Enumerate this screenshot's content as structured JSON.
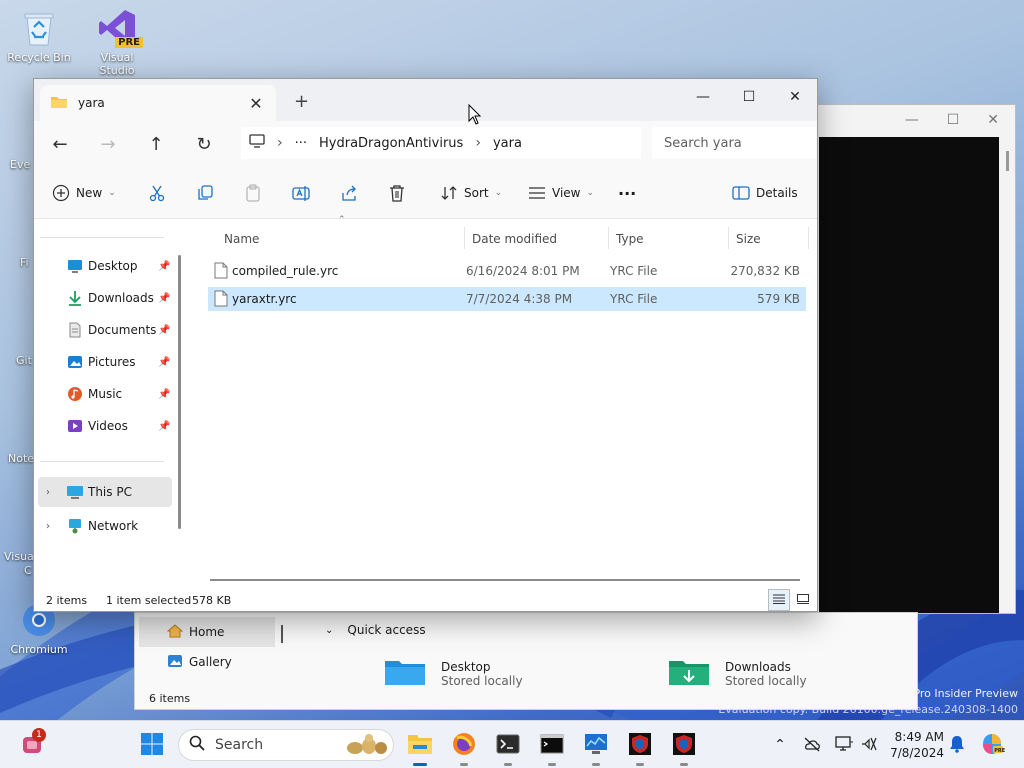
{
  "desktop": {
    "icons": [
      {
        "label": "Recycle Bin"
      },
      {
        "label": "Visual Studio",
        "badge": "PRE"
      }
    ],
    "edge_labels": [
      "Eve",
      "Fi",
      "Git",
      "Note",
      "Visua",
      "C",
      "Chromium"
    ],
    "watermark": [
      "Pro Insider Preview",
      "Evaluation copy. Build 26100.ge_release.240308-1400"
    ]
  },
  "explorer": {
    "tab_title": "yara",
    "window_controls": {
      "minimize": "—",
      "maximize": "☐",
      "close": "✕"
    },
    "breadcrumb": {
      "more": "···",
      "parts": [
        "HydraDragonAntivirus",
        "yara"
      ]
    },
    "search_placeholder": "Search yara",
    "toolbar": {
      "new": "New",
      "sort": "Sort",
      "view": "View",
      "more": "···",
      "details": "Details"
    },
    "nav": {
      "quick": [
        {
          "label": "Desktop",
          "icon": "desktop-icon",
          "color": "#1a8fd8"
        },
        {
          "label": "Downloads",
          "icon": "download-icon",
          "color": "#1a9e5c"
        },
        {
          "label": "Documents",
          "icon": "document-icon",
          "color": "#8a8a8a"
        },
        {
          "label": "Pictures",
          "icon": "picture-icon",
          "color": "#1a7fd4"
        },
        {
          "label": "Music",
          "icon": "music-icon",
          "color": "#e05a2b"
        },
        {
          "label": "Videos",
          "icon": "video-icon",
          "color": "#7b3fc4"
        }
      ],
      "this_pc": "This PC",
      "network": "Network"
    },
    "columns": {
      "name": "Name",
      "date": "Date modified",
      "type": "Type",
      "size": "Size"
    },
    "files": [
      {
        "name": "compiled_rule.yrc",
        "date": "6/16/2024 8:01 PM",
        "type": "YRC File",
        "size": "270,832 KB",
        "selected": false
      },
      {
        "name": "yaraxtr.yrc",
        "date": "7/7/2024 4:38 PM",
        "type": "YRC File",
        "size": "579 KB",
        "selected": true
      }
    ],
    "status": {
      "count": "2 items",
      "selected": "1 item selected",
      "size": "578 KB"
    }
  },
  "bg_explorer": {
    "nav": [
      "Home",
      "Gallery"
    ],
    "section": "Quick access",
    "tiles": [
      {
        "name": "Desktop",
        "sub": "Stored locally"
      },
      {
        "name": "Downloads",
        "sub": "Stored locally"
      }
    ],
    "count": "6 items"
  },
  "taskbar": {
    "search_label": "Search",
    "notification_count": "1",
    "time": "8:49 AM",
    "date": "7/8/2024"
  }
}
